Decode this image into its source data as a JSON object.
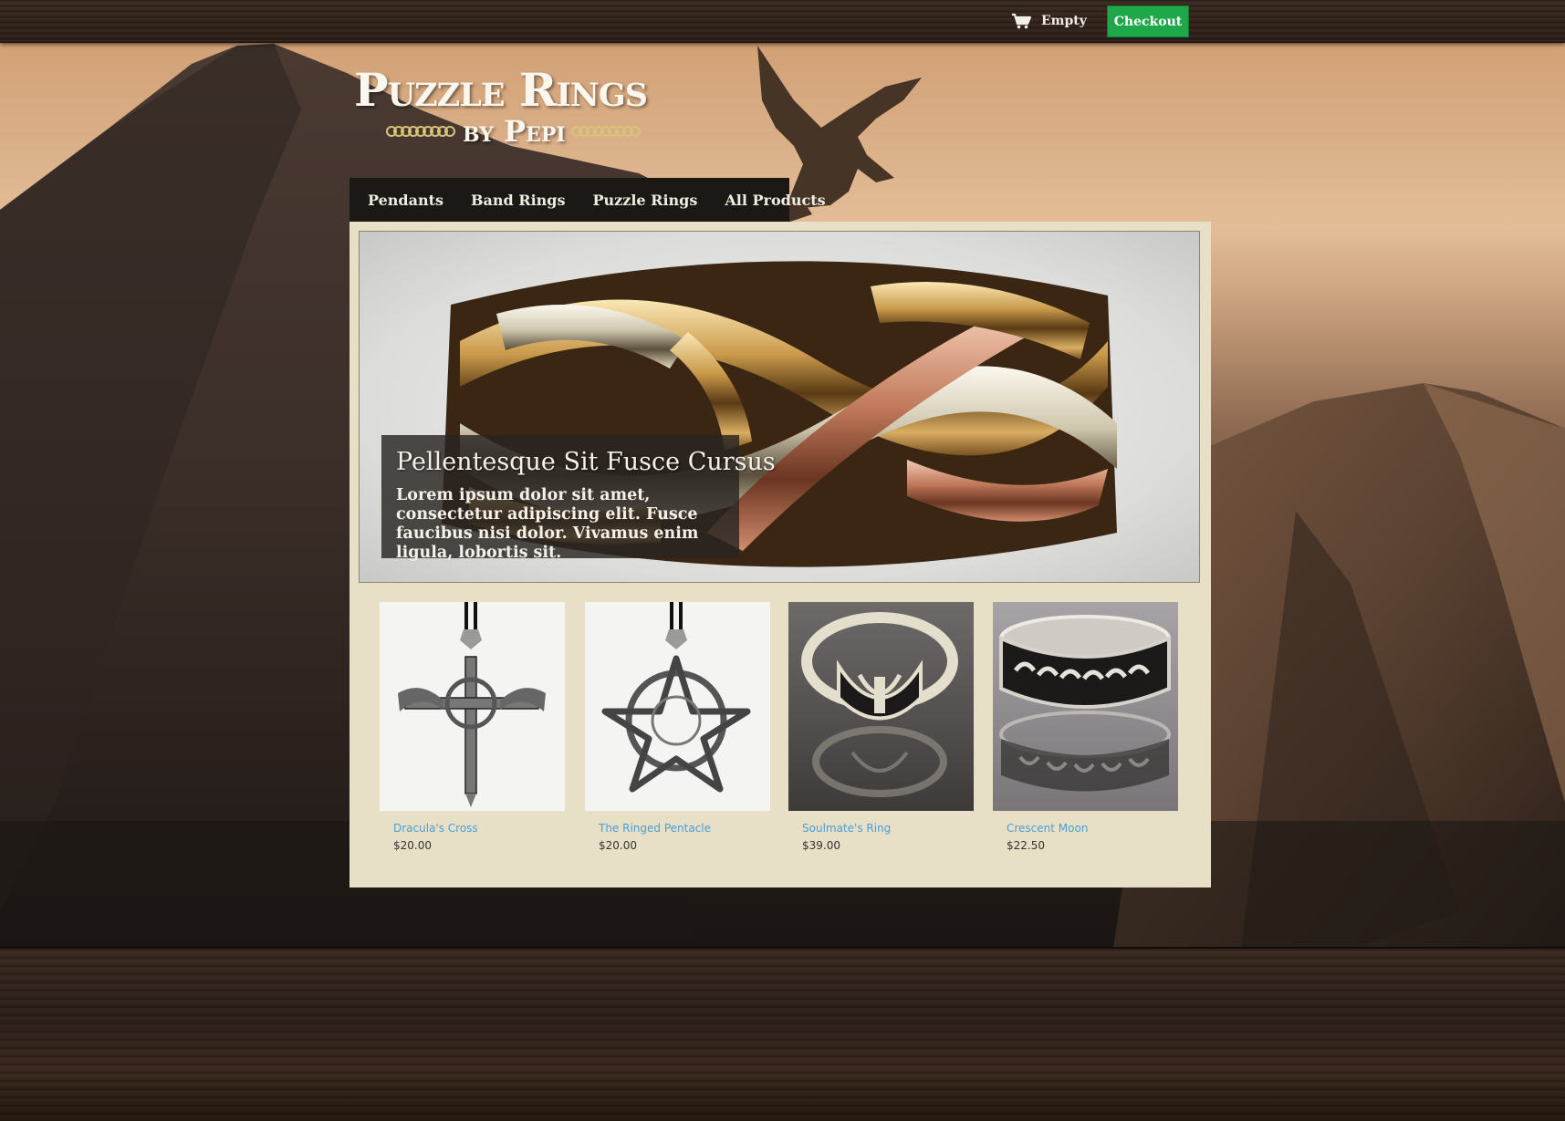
{
  "header": {
    "cart_label": "Empty",
    "checkout_label": "Checkout"
  },
  "logo": {
    "title": "Puzzle Rings",
    "subtitle": "by Pepi"
  },
  "nav": {
    "items": [
      {
        "label": "Pendants"
      },
      {
        "label": "Band Rings"
      },
      {
        "label": "Puzzle Rings"
      },
      {
        "label": "All Products"
      }
    ]
  },
  "hero": {
    "title": "Pellentesque Sit Fusce Cursus",
    "text": "Lorem ipsum dolor sit amet, consectetur adipiscing elit. Fusce faucibus nisi dolor. Vivamus enim ligula, lobortis sit."
  },
  "products": [
    {
      "name": "Dracula's Cross",
      "price": "$20.00"
    },
    {
      "name": "The Ringed Pentacle",
      "price": "$20.00"
    },
    {
      "name": "Soulmate's Ring",
      "price": "$39.00"
    },
    {
      "name": "Crescent Moon",
      "price": "$22.50"
    }
  ],
  "colors": {
    "checkout_bg": "#1fa84a",
    "panel_bg": "#e7dfc6",
    "nav_bg": "#1b1816",
    "product_link": "#4a9fd6"
  },
  "icons": {
    "cart": "shopping-cart-icon",
    "chain": "chain-ornament-icon",
    "dragon": "dragon-illustration"
  }
}
